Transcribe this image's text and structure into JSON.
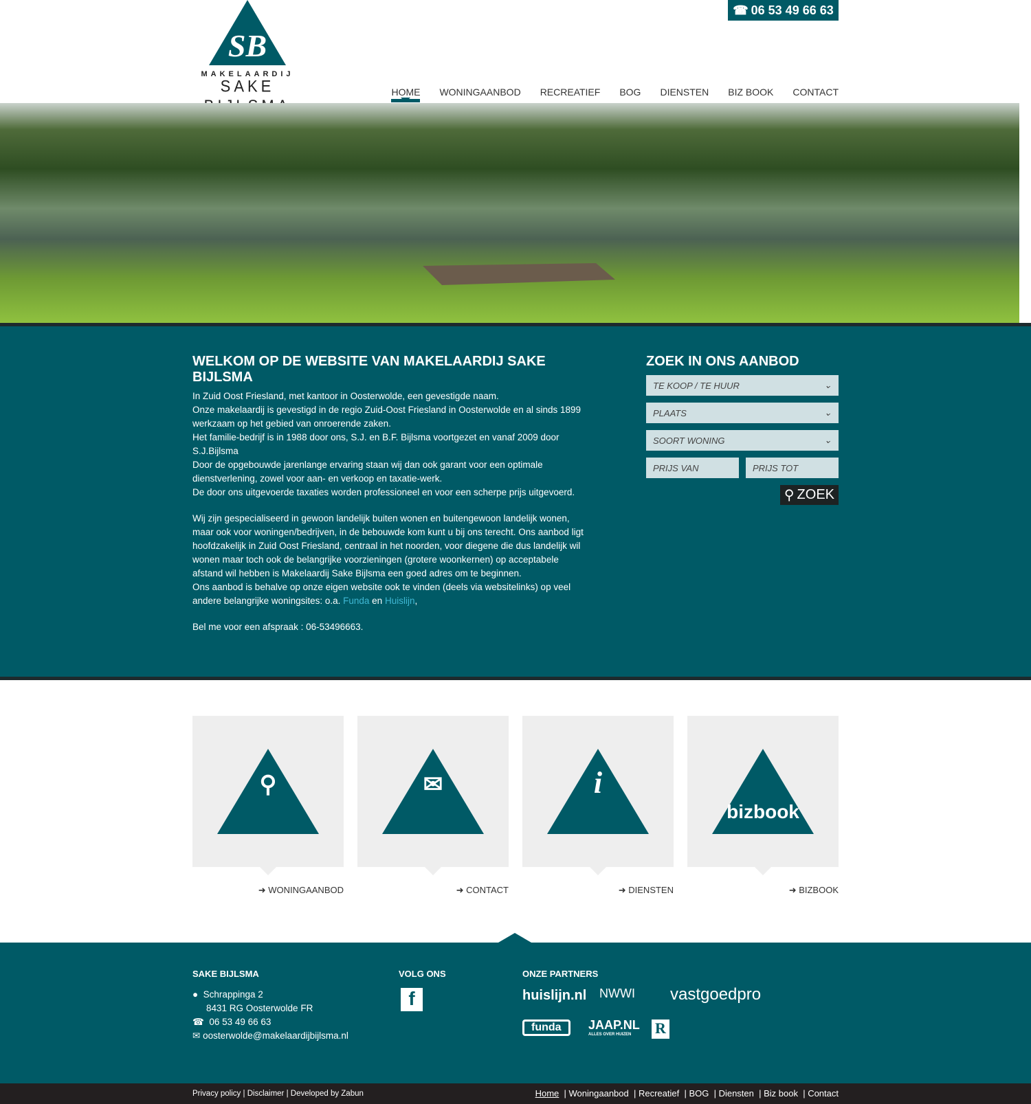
{
  "header": {
    "phone": "06 53 49 66 63",
    "logo": {
      "initials": "SB",
      "line1": "MAKELAARDIJ",
      "line2": "SAKE BIJLSMA"
    },
    "nav": [
      "HOME",
      "WONINGAANBOD",
      "RECREATIEF",
      "BOG",
      "DIENSTEN",
      "BIZ BOOK",
      "CONTACT"
    ],
    "active_nav": "HOME"
  },
  "welcome": {
    "title": "WELKOM OP DE WEBSITE VAN MAKELAARDIJ SAKE BIJLSMA",
    "p1": [
      "In Zuid Oost Friesland, met kantoor in Oosterwolde, een gevestigde naam.",
      "Onze makelaardij is gevestigd in de regio Zuid-Oost Friesland in Oosterwolde en al sinds 1899 werkzaam op het gebied van onroerende zaken.",
      "Het familie-bedrijf is in 1988 door ons, S.J. en B.F. Bijlsma voortgezet en vanaf 2009 door S.J.Bijlsma",
      "Door de opgebouwde jarenlange ervaring staan wij dan ook garant voor een optimale dienstverlening, zowel voor aan- en verkoop en taxatie-werk.",
      "De door ons uitgevoerde taxaties worden professioneel en voor een scherpe prijs uitgevoerd."
    ],
    "p2": "Wij zijn gespecialiseerd in gewoon landelijk buiten wonen en  buitengewoon  landelijk wonen,  maar ook voor woningen/bedrijven, in de bebouwde kom kunt u bij ons terecht. Ons aanbod ligt hoofdzakelijk in Zuid Oost Friesland, centraal in het noorden, voor diegene die dus landelijk wil wonen maar toch ook de belangrijke voorzieningen (grotere woonkernen) op acceptabele afstand wil hebben is Makelaardij Sake Bijlsma een goed adres om te beginnen.",
    "p3_pre": "Ons aanbod is behalve op onze eigen website ook te vinden (deels via websitelinks) op veel andere belangrijke woningsites: o.a. ",
    "link1": "Funda",
    "mid": " en  ",
    "link2": "Huislijn",
    "post": ",",
    "p4": "Bel me voor een afspraak : 06-53496663."
  },
  "search": {
    "title": "ZOEK IN ONS AANBOD",
    "select1": "TE KOOP / TE HUUR",
    "select2": "PLAATS",
    "select3": "SOORT WONING",
    "price_from": "PRIJS VAN",
    "price_to": "PRIJS TOT",
    "button": "ZOEK"
  },
  "tiles": [
    {
      "label": "WONINGAANBOD",
      "icon": "search-icon"
    },
    {
      "label": "CONTACT",
      "icon": "envelope-icon"
    },
    {
      "label": "DIENSTEN",
      "icon": "info-icon"
    },
    {
      "label": "BIZBOOK",
      "icon": "bizbook-logo",
      "logo_text": "bizbook"
    }
  ],
  "footer": {
    "col1_title": "SAKE BIJLSMA",
    "street": "Schrappinga 2",
    "city": "8431 RG Oosterwolde FR",
    "phone": "06 53 49 66 63",
    "email": "oosterwolde@makelaardijbijlsma.nl",
    "col2_title": "VOLG ONS",
    "col3_title": "ONZE PARTNERS",
    "partners": [
      "huislijn.nl",
      "NWWI",
      "vastgoedpro",
      "funda",
      "JAAP.NL",
      "R"
    ],
    "jaap_sub": "ALLES OVER HUIZEN"
  },
  "bottom": {
    "left": [
      "Privacy policy",
      "Disclaimer",
      "Developed by Zabun"
    ],
    "right": [
      "Home",
      "Woningaanbod",
      "Recreatief",
      "BOG",
      "Diensten",
      "Biz book",
      "Contact"
    ]
  },
  "colors": {
    "brand": "#005a66",
    "dark": "#231f20",
    "field": "#d0e0e3",
    "link": "#3fb8d4"
  }
}
